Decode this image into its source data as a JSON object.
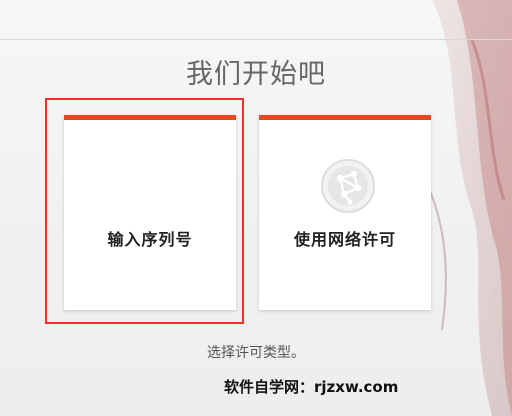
{
  "heading": "我们开始吧",
  "cards": [
    {
      "label": "输入序列号"
    },
    {
      "label": "使用网络许可"
    }
  ],
  "instruction": "选择许可类型。",
  "watermark": "软件自学网：rjzxw.com",
  "colors": {
    "accent": "#e8461f",
    "selection": "#e8342a"
  },
  "icons": {
    "network": "network-globe-icon"
  }
}
